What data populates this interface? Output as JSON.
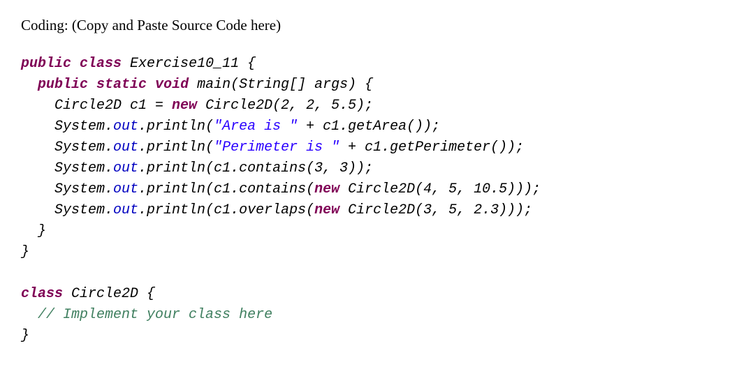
{
  "heading": "Coding:  (Copy and Paste Source Code here)",
  "code": {
    "l1_public": "public",
    "l1_class": "class",
    "l1_name": " Exercise10_11 {",
    "l2_indent": "  ",
    "l2_public": "public",
    "l2_static": "static",
    "l2_void": "void",
    "l2_rest": " main(String[] args) {",
    "l3_indent": "    Circle2D c1 = ",
    "l3_new": "new",
    "l3_rest": " Circle2D(2, 2, 5.5);",
    "l4_indent": "    System.",
    "l4_out": "out",
    "l4_mid": ".println(",
    "l4_str": "\"Area is \"",
    "l4_rest": " + c1.getArea());",
    "l5_indent": "    System.",
    "l5_out": "out",
    "l5_mid": ".println(",
    "l5_str": "\"Perimeter is \"",
    "l5_rest": " + c1.getPerimeter());",
    "l6_indent": "    System.",
    "l6_out": "out",
    "l6_rest": ".println(c1.contains(3, 3));",
    "l7_indent": "    System.",
    "l7_out": "out",
    "l7_mid": ".println(c1.contains(",
    "l7_new": "new",
    "l7_rest": " Circle2D(4, 5, 10.5)));",
    "l8_indent": "    System.",
    "l8_out": "out",
    "l8_mid": ".println(c1.overlaps(",
    "l8_new": "new",
    "l8_rest": " Circle2D(3, 5, 2.3)));",
    "l9": "  }",
    "l10": "}",
    "blank": "",
    "l12_class": "class",
    "l12_rest": " Circle2D {",
    "l13_indent": "  ",
    "l13_comment": "// Implement your class here",
    "l14": "}"
  }
}
